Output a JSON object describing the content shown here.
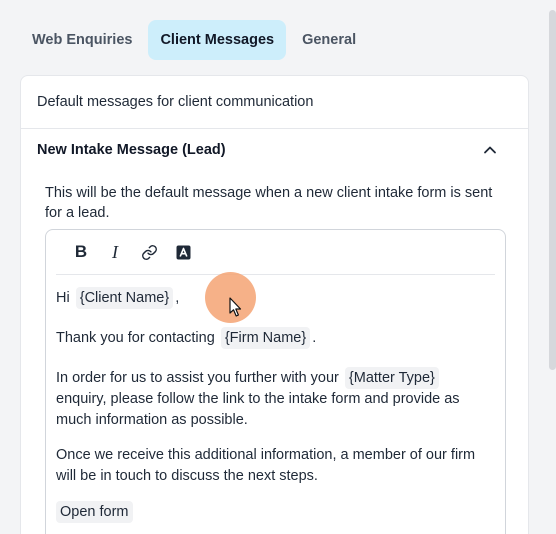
{
  "tabs": [
    {
      "label": "Web Enquiries",
      "active": false
    },
    {
      "label": "Client Messages",
      "active": true
    },
    {
      "label": "General",
      "active": false
    }
  ],
  "card": {
    "description": "Default messages for client communication",
    "section_title": "New Intake Message (Lead)",
    "helper_text": "This will be the default message when a new client intake form is sent for a lead."
  },
  "toolbar": {
    "bold_label": "B",
    "italic_label": "I",
    "icons": [
      "bold-icon",
      "italic-icon",
      "link-icon",
      "text-color-icon"
    ]
  },
  "message": {
    "greeting_prefix": "Hi",
    "client_var": "{Client Name}",
    "greeting_suffix": ",",
    "thanks_prefix": "Thank you for contacting",
    "firm_var": "{Firm Name}",
    "thanks_suffix": ".",
    "assist_prefix": "In order for us to assist you further with your",
    "matter_var": "{Matter Type}",
    "assist_suffix": "enquiry, please follow the link to the intake form and provide as much information as possible.",
    "closing": "Once we receive this additional information, a member of our firm will be in touch to discuss the next steps.",
    "open_form_label": "Open form"
  },
  "colors": {
    "active_tab_bg": "#cdeefb",
    "cursor_highlight": "#f4a373",
    "variable_chip_bg": "#f1f2f4"
  }
}
